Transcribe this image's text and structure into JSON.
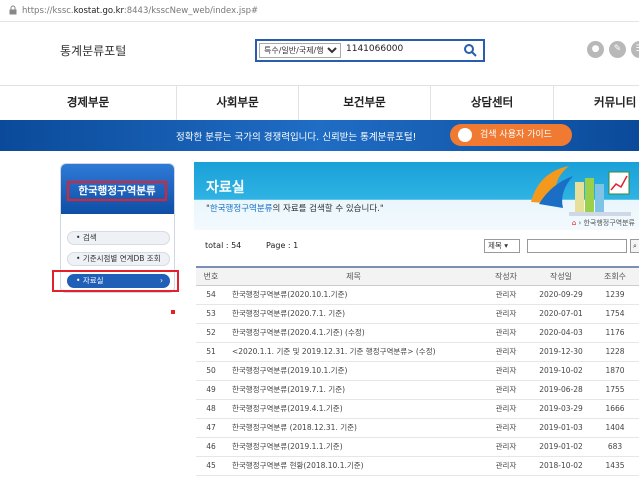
{
  "address_bar": {
    "url_prefix": "https://kssc.",
    "url_domain": "kostat.go.kr",
    "url_suffix": ":8443/ksscNew_web/index.jsp#"
  },
  "header": {
    "brand": "통계분류포털",
    "search_category": "특수/일반/국제/행정",
    "search_value": "1141066000"
  },
  "nav": {
    "items": [
      "경제부문",
      "사회부문",
      "보건부문",
      "상담센터",
      "커뮤니티"
    ]
  },
  "banner": {
    "message": "정확한 분류는 국가의 경쟁력입니다. 신뢰받는 통계분류포털!",
    "guide_button": "검색 사용자 가이드"
  },
  "sidebar": {
    "title": "한국행정구역분류",
    "items": [
      {
        "label": "검색"
      },
      {
        "label": "기준시점별 연계DB 조회"
      },
      {
        "label": "자료실"
      }
    ]
  },
  "hero": {
    "title": "자료실",
    "subtitle_quote_open": "\"",
    "subtitle_highlight": "한국행정구역분류",
    "subtitle_rest": "의 자료를 검색할 수 있습니다.\"",
    "breadcrumb": "› 한국행정구역분류"
  },
  "list_info": {
    "total_label": "total : 54",
    "page_label": "Page : 1",
    "filter_select": "제목"
  },
  "table": {
    "headers": [
      "번호",
      "제목",
      "작성자",
      "작성일",
      "조회수"
    ],
    "rows": [
      [
        "54",
        "한국행정구역분류(2020.10.1.기준)",
        "관리자",
        "2020-09-29",
        "1239"
      ],
      [
        "53",
        "한국행정구역분류(2020.7.1. 기준)",
        "관리자",
        "2020-07-01",
        "1754"
      ],
      [
        "52",
        "한국행정구역분류(2020.4.1.기준) (수정)",
        "관리자",
        "2020-04-03",
        "1176"
      ],
      [
        "51",
        "<2020.1.1. 기준 및 2019.12.31. 기준 행정구역분류> (수정)",
        "관리자",
        "2019-12-30",
        "1228"
      ],
      [
        "50",
        "한국행정구역분류(2019.10.1.기준)",
        "관리자",
        "2019-10-02",
        "1870"
      ],
      [
        "49",
        "한국행정구역분류(2019.7.1. 기준)",
        "관리자",
        "2019-06-28",
        "1755"
      ],
      [
        "48",
        "한국행정구역분류(2019.4.1.기준)",
        "관리자",
        "2019-03-29",
        "1666"
      ],
      [
        "47",
        "한국행정구역분류 (2018.12.31. 기준)",
        "관리자",
        "2019-01-03",
        "1404"
      ],
      [
        "46",
        "한국행정구역분류(2019.1.1.기준)",
        "관리자",
        "2019-01-02",
        "683"
      ],
      [
        "45",
        "한국행정구역분류 현황(2018.10.1.기준)",
        "관리자",
        "2018-10-02",
        "1435"
      ]
    ]
  },
  "colors": {
    "primary_blue": "#1f5fb8",
    "highlight_red": "#e4202a",
    "guide_orange": "#f07a32",
    "hero_cyan": "#1aa0d8"
  }
}
